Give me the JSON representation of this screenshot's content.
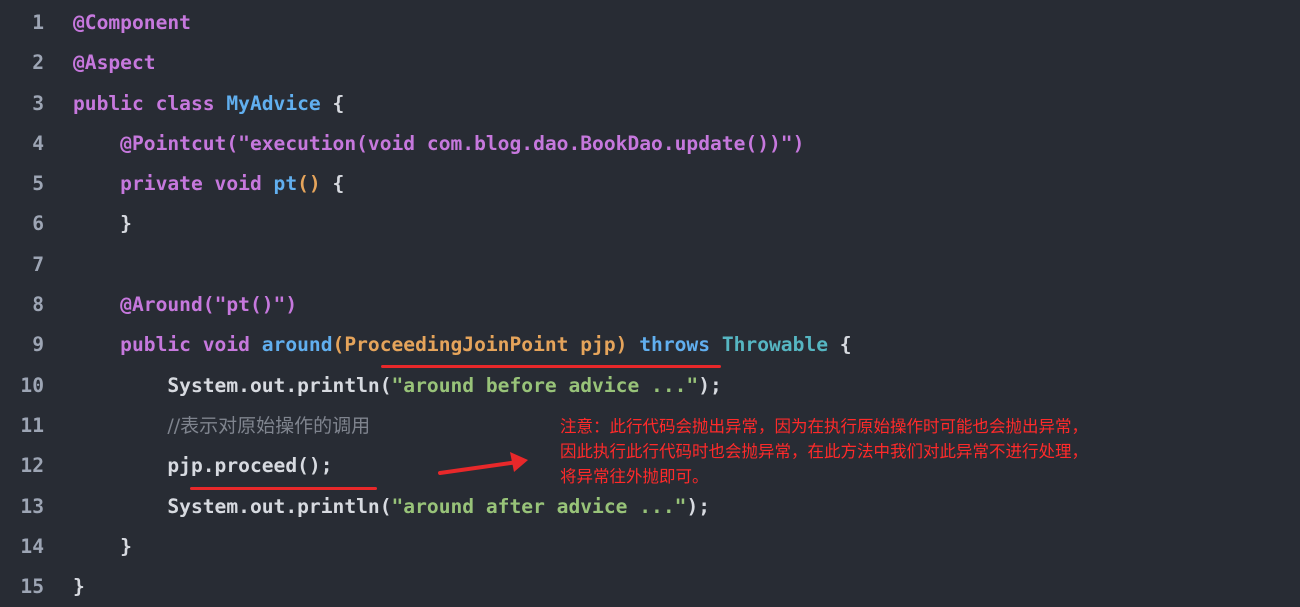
{
  "lines": [
    {
      "n": "1",
      "parts": [
        {
          "t": "@Component",
          "c": "anno"
        }
      ]
    },
    {
      "n": "2",
      "parts": [
        {
          "t": "@Aspect",
          "c": "anno"
        }
      ]
    },
    {
      "n": "3",
      "parts": [
        {
          "t": "public class ",
          "c": "kw"
        },
        {
          "t": "MyAdvice",
          "c": "fn"
        },
        {
          "t": " {",
          "c": "plain"
        }
      ]
    },
    {
      "n": "4",
      "parts": [
        {
          "t": "    @Pointcut(",
          "c": "anno"
        },
        {
          "t": "\"execution(void com.blog.dao.BookDao.update())\"",
          "c": "kw"
        },
        {
          "t": ")",
          "c": "anno"
        }
      ]
    },
    {
      "n": "5",
      "parts": [
        {
          "t": "    private void ",
          "c": "kw"
        },
        {
          "t": "pt",
          "c": "fn"
        },
        {
          "t": "()",
          "c": "paren"
        },
        {
          "t": " {",
          "c": "plain"
        }
      ]
    },
    {
      "n": "6",
      "parts": [
        {
          "t": "    }",
          "c": "plain"
        }
      ]
    },
    {
      "n": "7",
      "parts": []
    },
    {
      "n": "8",
      "parts": [
        {
          "t": "    @Around(",
          "c": "anno"
        },
        {
          "t": "\"pt()\"",
          "c": "kw"
        },
        {
          "t": ")",
          "c": "anno"
        }
      ]
    },
    {
      "n": "9",
      "parts": [
        {
          "t": "    public void ",
          "c": "kw"
        },
        {
          "t": "around",
          "c": "fn"
        },
        {
          "t": "(ProceedingJoinPoint pjp)",
          "c": "paren"
        },
        {
          "t": " throws ",
          "c": "fn"
        },
        {
          "t": "Throwable",
          "c": "type"
        },
        {
          "t": " {",
          "c": "plain"
        }
      ]
    },
    {
      "n": "10",
      "parts": [
        {
          "t": "        System.out.println(",
          "c": "plain"
        },
        {
          "t": "\"around before advice ...\"",
          "c": "str"
        },
        {
          "t": ");",
          "c": "plain"
        }
      ]
    },
    {
      "n": "11",
      "parts": [
        {
          "t": "        ",
          "c": "plain"
        },
        {
          "t": "//表示对原始操作的调用",
          "c": "comment"
        }
      ]
    },
    {
      "n": "12",
      "parts": [
        {
          "t": "        pjp.proceed();",
          "c": "plain"
        }
      ]
    },
    {
      "n": "13",
      "parts": [
        {
          "t": "        System.out.println(",
          "c": "plain"
        },
        {
          "t": "\"around after advice ...\"",
          "c": "str"
        },
        {
          "t": ");",
          "c": "plain"
        }
      ]
    },
    {
      "n": "14",
      "parts": [
        {
          "t": "    }",
          "c": "plain"
        }
      ]
    },
    {
      "n": "15",
      "parts": [
        {
          "t": "}",
          "c": "plain"
        }
      ]
    }
  ],
  "annotation": {
    "note_line1": "注意：此行代码会抛出异常，因为在执行原始操作时可能也会抛出异常，",
    "note_line2": "因此执行此行代码时也会抛异常，在此方法中我们对此异常不进行处理，",
    "note_line3": "将异常往外抛即可。",
    "color": "#ff2a2a"
  }
}
